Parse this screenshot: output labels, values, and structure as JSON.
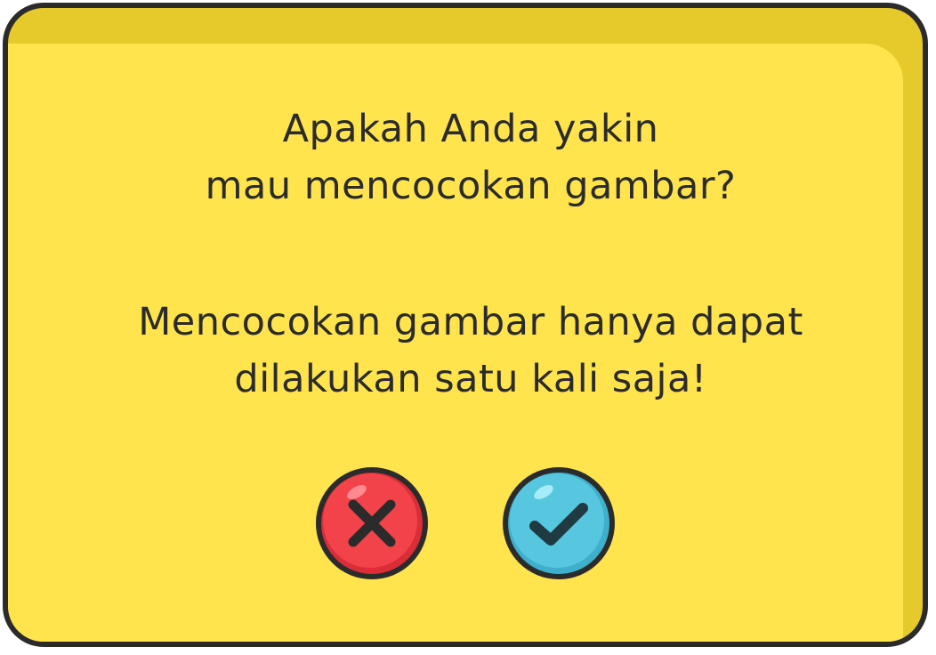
{
  "dialog": {
    "question_lines": [
      "Apakah Anda yakin",
      "mau mencocokan gambar?"
    ],
    "warning_lines": [
      "Mencocokan gambar hanya dapat",
      "dilakukan satu kali saja!"
    ],
    "buttons": {
      "cancel": {
        "icon": "close-icon",
        "color": "#f2434b"
      },
      "confirm": {
        "icon": "check-icon",
        "color": "#57c7e0"
      }
    },
    "colors": {
      "panel": "#ffe44d",
      "panel_shadow": "#e6c92a",
      "outline": "#2b2b2b"
    }
  }
}
